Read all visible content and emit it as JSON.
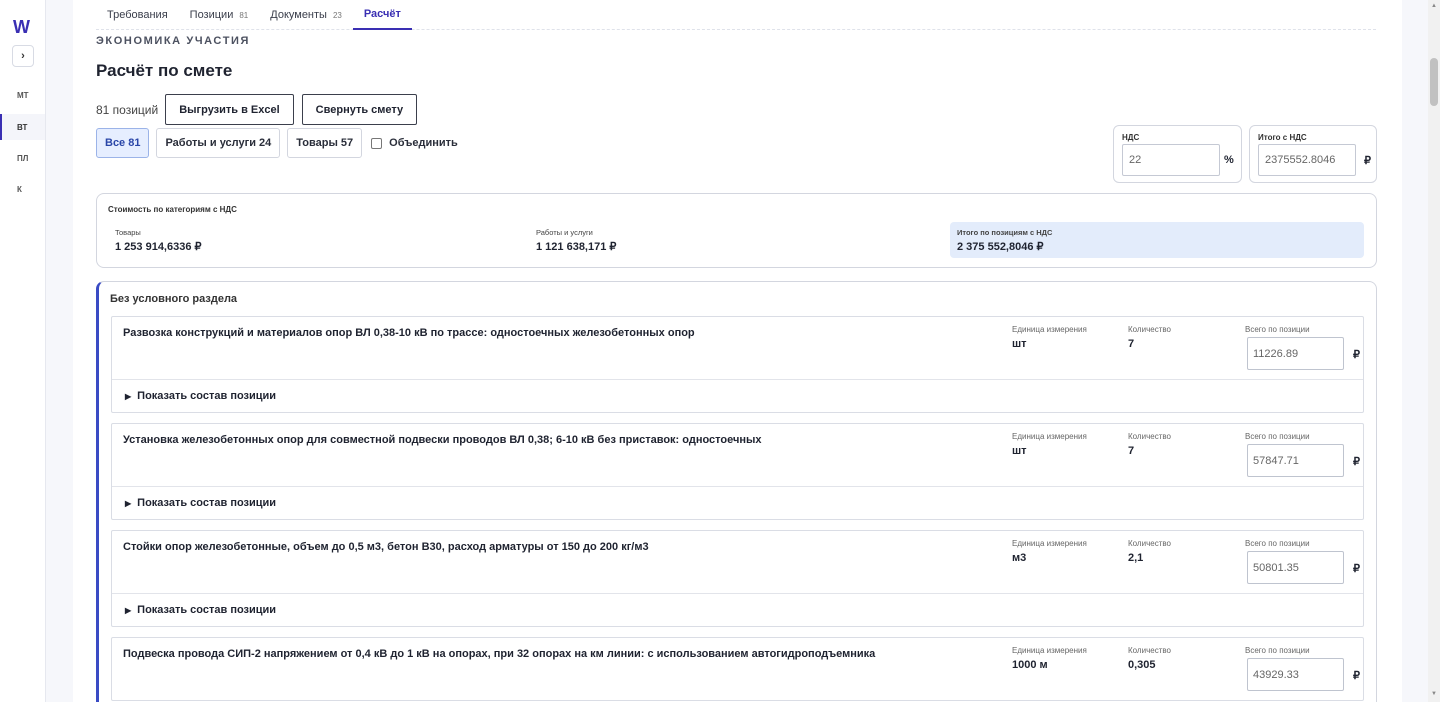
{
  "rail": {
    "logo": "W",
    "toggle": "›",
    "items": [
      "МТ",
      "ВТ",
      "ПЛ",
      "К"
    ]
  },
  "tabs": [
    {
      "label": "Требования",
      "count": ""
    },
    {
      "label": "Позиции",
      "count": "81"
    },
    {
      "label": "Документы",
      "count": "23"
    },
    {
      "label": "Расчёт",
      "count": ""
    }
  ],
  "header": {
    "eyebrow": "ЭКОНОМИКА УЧАСТИЯ",
    "title": "Расчёт по смете"
  },
  "toolbar": {
    "count_text": "81 позиций",
    "export_label": "Выгрузить в Excel",
    "collapse_label": "Свернуть смету"
  },
  "filters": {
    "all": "Все 81",
    "works": "Работы и услуги 24",
    "goods": "Товары 57",
    "merge_label": "Объединить",
    "merge_checked": false
  },
  "vat": {
    "label": "НДС",
    "value": "22",
    "unit": "%"
  },
  "total_vat": {
    "label": "Итого с НДС",
    "value": "2375552.8046",
    "unit": "₽"
  },
  "categories": {
    "title": "Стоимость по категориям с НДС",
    "goods_label": "Товары",
    "goods_value": "1 253 914,6336 ₽",
    "works_label": "Работы и услуги",
    "works_value": "1 121 638,171 ₽",
    "total_label": "Итого по позициям с НДС",
    "total_value": "2 375 552,8046 ₽"
  },
  "section": {
    "title": "Без условного раздела",
    "unit_col": "Единица измерения",
    "qty_col": "Количество",
    "total_col": "Всего по позиции",
    "currency": "₽",
    "expand_label": "Показать состав позиции",
    "items": [
      {
        "name": "Развозка конструкций и материалов опор ВЛ 0,38-10 кВ по трассе: одностоечных железобетонных опор",
        "unit": "шт",
        "qty": "7",
        "total": "11226.89"
      },
      {
        "name": "Установка железобетонных опор для совместной подвески проводов ВЛ 0,38; 6-10 кВ без приставок: одностоечных",
        "unit": "шт",
        "qty": "7",
        "total": "57847.71"
      },
      {
        "name": "Стойки опор железобетонные, объем до 0,5 м3, бетон В30, расход арматуры от 150 до 200 кг/м3",
        "unit": "м3",
        "qty": "2,1",
        "total": "50801.35"
      },
      {
        "name": "Подвеска провода СИП-2 напряжением от 0,4 кВ до 1 кВ на опорах, при 32 опорах на км линии: с использованием автогидроподъемника",
        "unit": "1000 м",
        "qty": "0,305",
        "total": "43929.33"
      }
    ]
  }
}
